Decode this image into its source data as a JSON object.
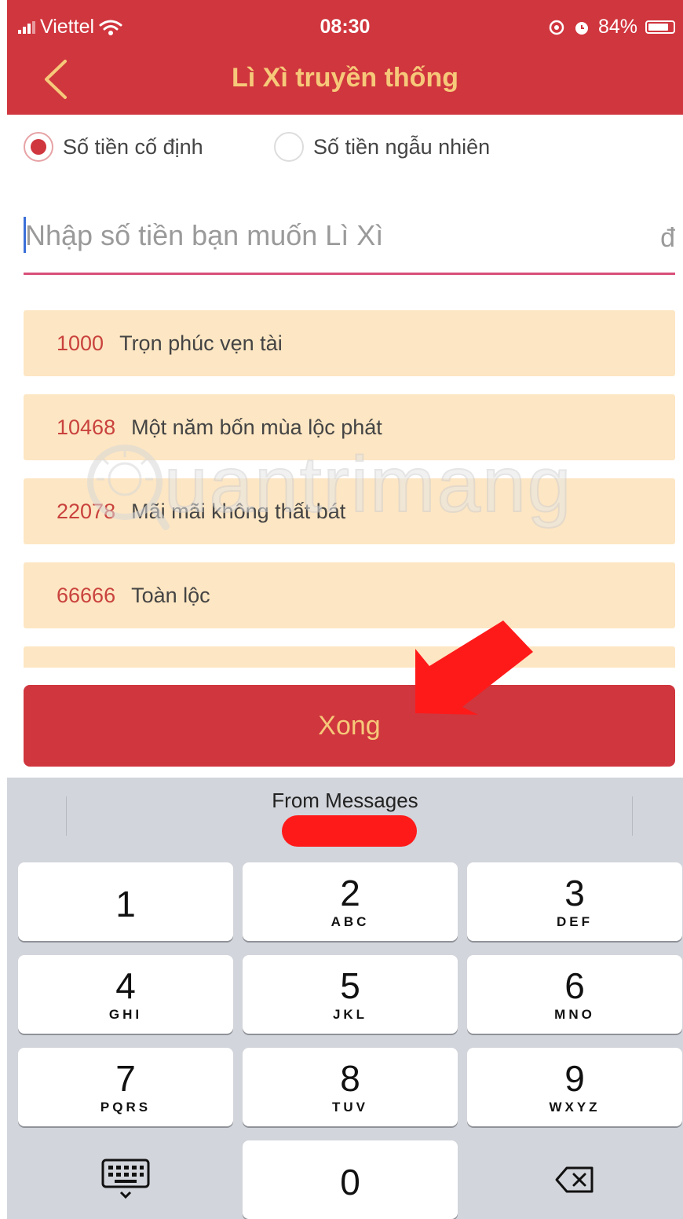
{
  "status_bar": {
    "carrier": "Viettel",
    "time": "08:30",
    "battery": "84%",
    "battery_level": 0.84
  },
  "nav": {
    "title": "Lì Xì truyền thống"
  },
  "options": [
    {
      "label": "Số tiền cố định",
      "selected": true
    },
    {
      "label": "Số tiền ngẫu nhiên",
      "selected": false
    }
  ],
  "amount_field": {
    "placeholder": "Nhập số tiền bạn muốn Lì Xì",
    "value": "",
    "currency": "đ"
  },
  "presets": [
    {
      "amount": "1000",
      "text": "Trọn phúc vẹn tài"
    },
    {
      "amount": "10468",
      "text": "Một năm bốn mùa lộc phát"
    },
    {
      "amount": "22078",
      "text": "Mãi mãi không thất bát"
    },
    {
      "amount": "66666",
      "text": "Toàn lộc"
    }
  ],
  "watermark": "uantrimang",
  "done_label": "Xong",
  "keyboard": {
    "suggestion": "From Messages",
    "keys": [
      {
        "num": "1",
        "letters": ""
      },
      {
        "num": "2",
        "letters": "ABC"
      },
      {
        "num": "3",
        "letters": "DEF"
      },
      {
        "num": "4",
        "letters": "GHI"
      },
      {
        "num": "5",
        "letters": "JKL"
      },
      {
        "num": "6",
        "letters": "MNO"
      },
      {
        "num": "7",
        "letters": "PQRS"
      },
      {
        "num": "8",
        "letters": "TUV"
      },
      {
        "num": "9",
        "letters": "WXYZ"
      },
      {
        "num": "0",
        "letters": ""
      }
    ],
    "icons": {
      "hide": "keyboard-hide-icon",
      "delete": "backspace-icon"
    }
  },
  "colors": {
    "brand_red": "#d0363e",
    "title_gold": "#f6c97a",
    "preset_bg": "#fde6c3",
    "amount_red": "#c9423d",
    "underline_pink": "#d94f7a",
    "annotation_red": "#ff1a1a",
    "keyboard_bg": "#d2d5db"
  }
}
